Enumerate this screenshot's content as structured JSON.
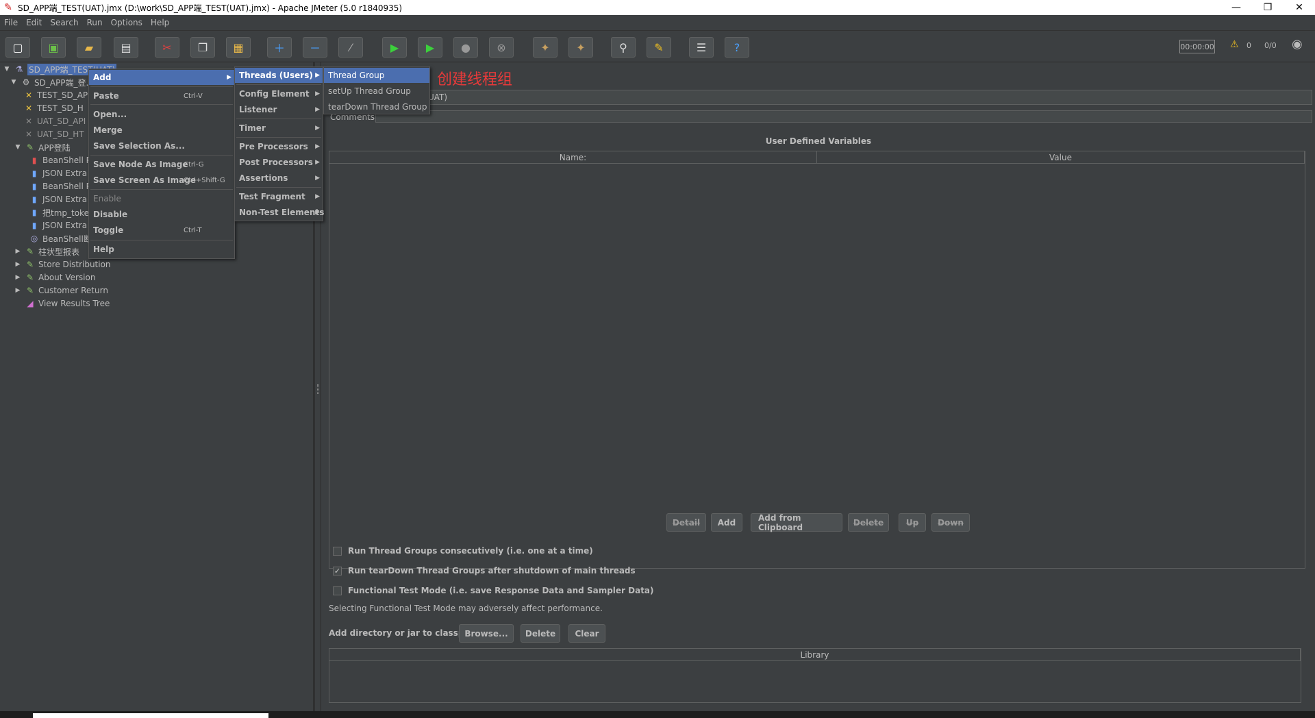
{
  "window": {
    "title": "SD_APP端_TEST(UAT).jmx (D:\\work\\SD_APP端_TEST(UAT).jmx) - Apache JMeter (5.0 r1840935)",
    "minimize": "—",
    "maximize": "❐",
    "close": "✕"
  },
  "menubar": [
    "File",
    "Edit",
    "Search",
    "Run",
    "Options",
    "Help"
  ],
  "toolbar": {
    "timer": "00:00:00",
    "warnings": "0",
    "threads": "0/0"
  },
  "tree": {
    "root": "SD_APP端_TEST(UAT)",
    "items": [
      "SD_APP端_登...",
      "TEST_SD_AP",
      "TEST_SD_H",
      "UAT_SD_API",
      "UAT_SD_HT",
      "APP登陆",
      "BeanShell P",
      "JSON Extra",
      "BeanShell P",
      "JSON Extra",
      "把tmp_toke",
      "JSON Extra",
      "BeanShell断",
      "柱状型报表",
      "Store Distribution",
      "About Version",
      "Customer Return",
      "View Results Tree"
    ]
  },
  "context_menu": {
    "items": [
      "Add",
      "Paste",
      "Open...",
      "Merge",
      "Save Selection As...",
      "Save Node As Image",
      "Save Screen As Image",
      "Enable",
      "Disable",
      "Toggle",
      "Help"
    ],
    "accelerators": {
      "paste": "Ctrl-V",
      "save_node": "Ctrl-G",
      "save_screen": "Ctrl+Shift-G",
      "toggle": "Ctrl-T"
    }
  },
  "add_submenu": [
    "Threads (Users)",
    "Config Element",
    "Listener",
    "Timer",
    "Pre Processors",
    "Post Processors",
    "Assertions",
    "Test Fragment",
    "Non-Test Elements"
  ],
  "threads_submenu": [
    "Thread Group",
    "setUp Thread Group",
    "tearDown Thread Group"
  ],
  "annotation": "创建线程组",
  "right_panel": {
    "name_value_visible": "UAT)",
    "comments_label": "Comments:",
    "udv_title": "User Defined Variables",
    "table_headers": [
      "Name:",
      "Value"
    ],
    "buttons": [
      "Detail",
      "Add",
      "Add from Clipboard",
      "Delete",
      "Up",
      "Down"
    ],
    "checkboxes": [
      {
        "label": "Run Thread Groups consecutively (i.e. one at a time)",
        "checked": false
      },
      {
        "label": "Run tearDown Thread Groups after shutdown of main threads",
        "checked": true
      },
      {
        "label": "Functional Test Mode (i.e. save Response Data and Sampler Data)",
        "checked": false
      }
    ],
    "functional_note": "Selecting Functional Test Mode may adversely affect performance.",
    "classpath_label": "Add directory or jar to classpath",
    "classpath_buttons": [
      "Browse...",
      "Delete",
      "Clear"
    ],
    "library_header": "Library"
  },
  "colors": {
    "background": "#3c3f41",
    "selection": "#4b6eaf",
    "annotation": "#e83a3a"
  }
}
